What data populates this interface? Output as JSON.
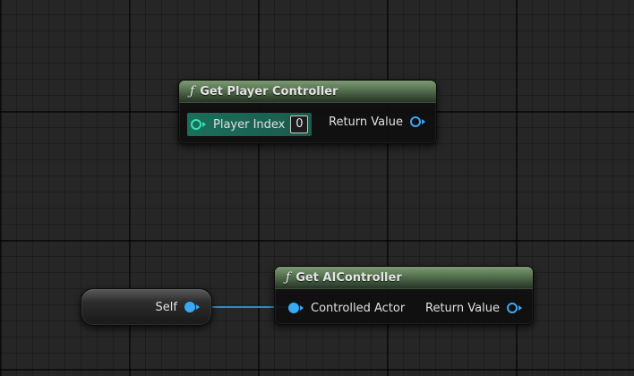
{
  "graph": {
    "nodes": {
      "get_player_controller": {
        "title": "Get Player Controller",
        "title_icon": "ƒ",
        "inputs": {
          "player_index": {
            "label": "Player Index",
            "value": "0"
          }
        },
        "outputs": {
          "return_value": {
            "label": "Return Value"
          }
        }
      },
      "get_ai_controller": {
        "title": "Get AIController",
        "title_icon": "ƒ",
        "inputs": {
          "controlled_actor": {
            "label": "Controlled Actor"
          }
        },
        "outputs": {
          "return_value": {
            "label": "Return Value"
          }
        }
      },
      "self": {
        "label": "Self"
      }
    },
    "colors": {
      "object_pin": "#38a9f4",
      "int_pin": "#35e3b4",
      "function_header": "#5d7a57",
      "background": "#262626"
    },
    "icons": {
      "function": "function-icon",
      "object_pin": "object-pin-icon",
      "int_pin": "integer-pin-icon"
    }
  }
}
